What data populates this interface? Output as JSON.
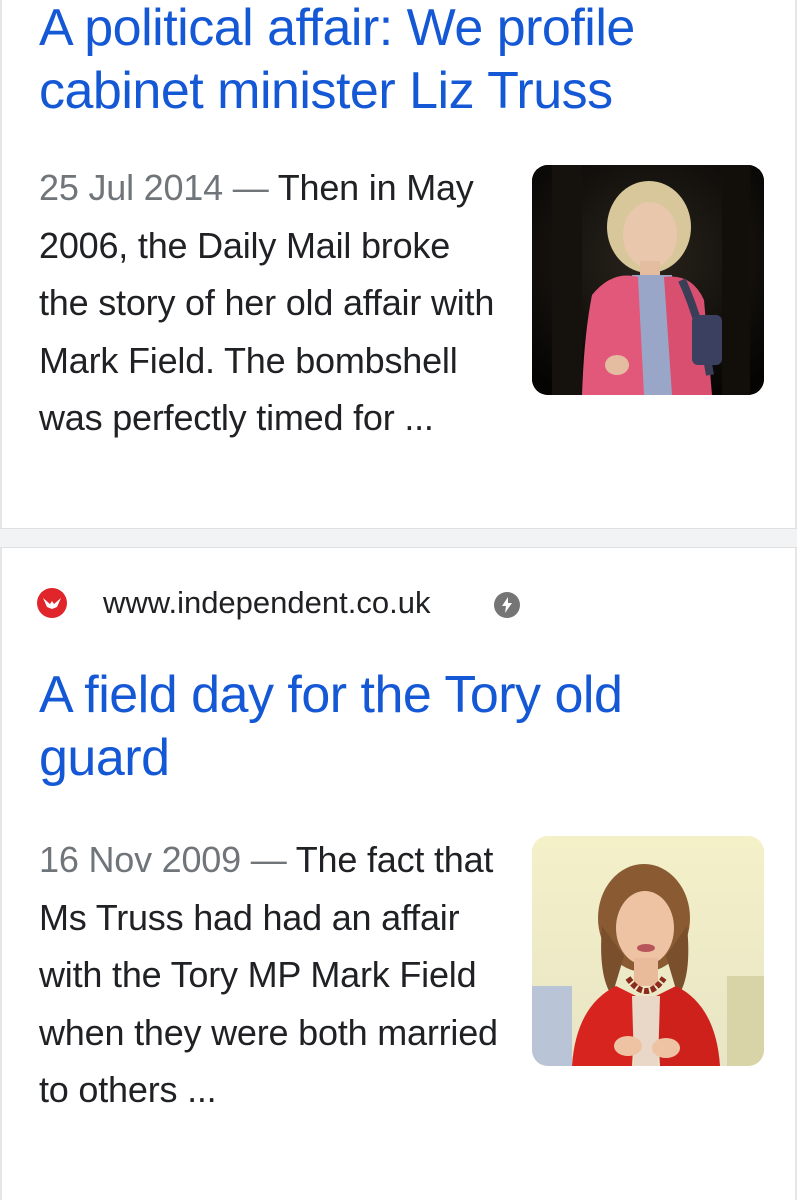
{
  "results": [
    {
      "title": "A political affair: We profile cabinet minister Liz Truss",
      "date": "25 Jul 2014",
      "separator": "—",
      "snippet": "Then in May 2006, the Daily Mail broke the story of her old affair with Mark Field. The bombshell was perfectly timed for ...",
      "thumbnail_icon": "photo-woman-pink-jacket"
    },
    {
      "source_icon": "independent-eagle-icon",
      "source_url": "www.independent.co.uk",
      "amp_icon": "amp-lightning-icon",
      "title": "A field day for the Tory old guard",
      "date": "16 Nov 2009",
      "separator": "—",
      "snippet": "The fact that Ms Truss had had an affair with the Tory MP Mark Field when they were both married to others ...",
      "thumbnail_icon": "photo-woman-red-jacket"
    }
  ],
  "colors": {
    "title_link": "#1558d6",
    "date": "#70757a",
    "text": "#202124",
    "independent_red": "#e0262b",
    "amp_grey": "#757575"
  }
}
